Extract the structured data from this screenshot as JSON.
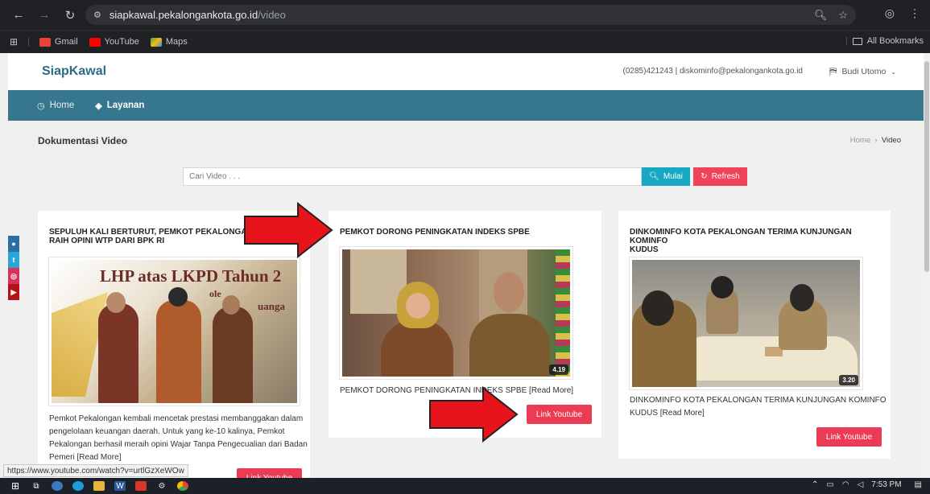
{
  "browser": {
    "url_host": "siapkawal.pekalongankota.go.id",
    "url_path": "/video",
    "bookmarks": [
      "Gmail",
      "YouTube",
      "Maps"
    ],
    "all_bookmarks": "All Bookmarks"
  },
  "site": {
    "brand": "SiapKawal",
    "contact": "(0285)421243 | diskominfo@pekalongankota.go.id",
    "user": "Budi Utomo"
  },
  "nav": {
    "home": "Home",
    "layanan": "Layanan"
  },
  "page": {
    "title": "Dokumentasi Video",
    "breadcrumb_home": "Home",
    "breadcrumb_sep": "›",
    "breadcrumb_current": "Video"
  },
  "search": {
    "placeholder": "Cari Video . . .",
    "mulai": "Mulai",
    "refresh": "Refresh"
  },
  "social": [
    "gplus",
    "twitter",
    "instagram",
    "youtube"
  ],
  "cards": [
    {
      "title_line1": "SEPULUH KALI BERTURUT, PEMKOT PEKALONGAN",
      "title_line2": "RAIH OPINI WTP DARI BPK RI",
      "desc_line1": "Pemkot Pekalongan kembali mencetak prestasi membanggakan dalam",
      "desc_line2": "pengelolaan keuangan daerah. Untuk yang ke-10 kalinya, Pemkot",
      "desc_line3": "Pekalongan berhasil meraih opini Wajar Tanpa Pengecualian dari Badan",
      "desc_line4": "Pemeri [Read More]",
      "button": "Link Youtube",
      "banner_text": "LHP atas LKPD Tahun 2",
      "banner_sub": "ole",
      "banner_sub2": "uanga"
    },
    {
      "title_line1": "PEMKOT DORONG PENINGKATAN INDEKS SPBE",
      "duration": "4.19",
      "desc_line1": "PEMKOT DORONG PENINGKATAN INDEKS SPBE [Read More]",
      "button": "Link Youtube"
    },
    {
      "title_line1": "DINKOMINFO KOTA PEKALONGAN TERIMA KUNJUNGAN KOMINFO",
      "title_line2": "KUDUS",
      "duration": "3.20",
      "desc_line1": "DINKOMINFO KOTA PEKALONGAN TERIMA KUNJUNGAN KOMINFO",
      "desc_line2": "KUDUS [Read More]",
      "button": "Link Youtube"
    }
  ],
  "status_url": "https://www.youtube.com/watch?v=urtlGzXeWOw",
  "taskbar": {
    "time": "7:53 PM"
  },
  "colors": {
    "brand": "#2a6b86",
    "nav_bg": "#36768e",
    "btn_mulai": "#17a9c4",
    "btn_refresh": "#f0435a",
    "btn_youtube": "#ec3b54",
    "arrow": "#e8141b"
  }
}
